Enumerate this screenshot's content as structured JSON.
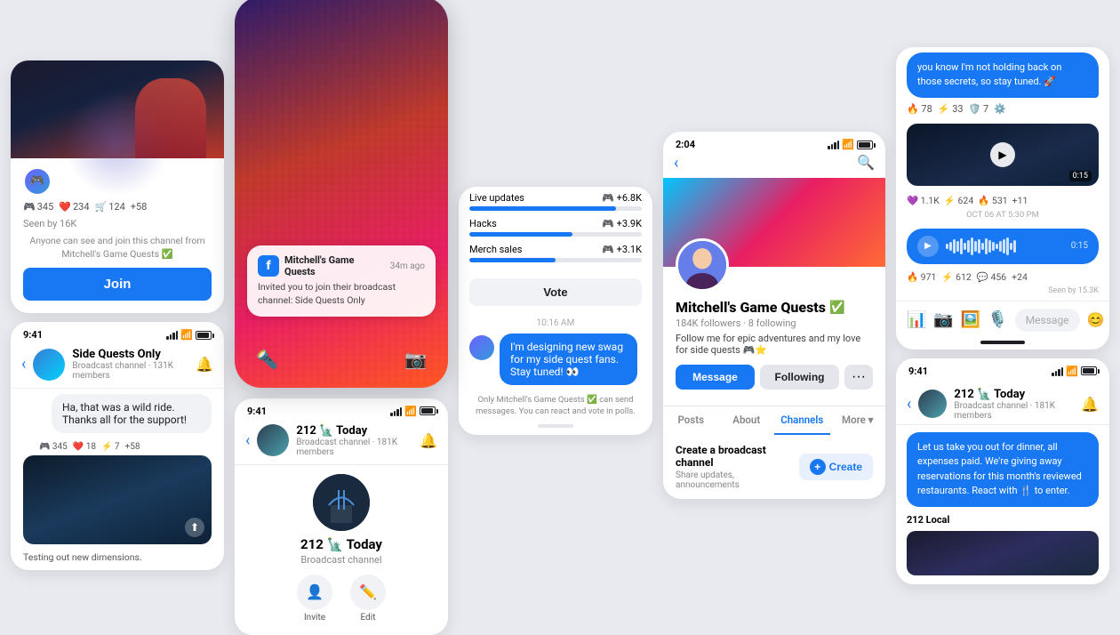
{
  "col1": {
    "card_top": {
      "reaction_items": [
        {
          "icon": "🎮",
          "count": "345"
        },
        {
          "icon": "❤️",
          "count": "234"
        },
        {
          "icon": "🛒",
          "count": "124"
        },
        {
          "icon": "",
          "count": "+58"
        }
      ],
      "seen_text": "Seen by 16K",
      "join_note": "Anyone can see and join this channel from Mitchell's Game Quests ✅",
      "join_button": "Join"
    },
    "card_chat": {
      "status_time": "9:41",
      "channel_name": "Side Quests Only",
      "channel_sub": "Broadcast channel · 131K members",
      "message": "Ha, that was a wild ride. Thanks all for the support!",
      "reactions": [
        {
          "icon": "🎮",
          "count": "345"
        },
        {
          "icon": "❤️",
          "count": "18"
        },
        {
          "icon": "⚡",
          "count": "7"
        },
        {
          "icon": "",
          "count": "+58"
        }
      ],
      "image_caption": "Testing out new dimensions."
    }
  },
  "col2": {
    "notification": {
      "sender": "Mitchell's Game Quests",
      "time": "34m ago",
      "body": "Invited you to join their broadcast channel: Side Quests Only"
    },
    "flashlight_icon": "🔦",
    "camera_icon": "📷",
    "broadcast": {
      "status_time": "9:41",
      "title": "212 🗽 Today",
      "subtitle": "Broadcast channel",
      "members": "181K members",
      "action_invite": "Invite",
      "action_edit": "Edit"
    }
  },
  "col3": {
    "poll": {
      "time": "10:16 AM",
      "items": [
        {
          "label": "Live updates",
          "stat": "🎮 +6.8K",
          "fill": 85,
          "color": "#1877f2"
        },
        {
          "label": "Hacks",
          "stat": "🎮 +3.9K",
          "fill": 60,
          "color": "#1877f2"
        },
        {
          "label": "Merch sales",
          "stat": "🎮 +3.1K",
          "fill": 50,
          "color": "#1877f2"
        }
      ],
      "vote_label": "Vote",
      "reply_time": "10:16 AM",
      "reply_message": "I'm designing new swag for my side quest fans. Stay tuned! 👀",
      "only_note": "Only Mitchell's Game Quests ✅ can send messages. You can react and vote in polls."
    }
  },
  "col4": {
    "profile": {
      "status_time": "2:04",
      "name": "Mitchell's Game Quests",
      "verified": true,
      "followers": "184K followers",
      "following": "8 following",
      "bio": "Follow me for epic adventures and my love for side quests 🎮⭐",
      "btn_message": "Message",
      "btn_following": "Following",
      "tabs": [
        "Posts",
        "About",
        "Channels",
        "More ▾"
      ],
      "active_tab": "Channels",
      "create_title": "Create a broadcast channel",
      "create_sub": "Share updates, announcements",
      "create_btn": "Create"
    }
  },
  "col5": {
    "card_top": {
      "message": "you know I'm not holding back on those secrets, so stay tuned. 🚀",
      "reactions": [
        {
          "icon": "🔥",
          "count": "78"
        },
        {
          "icon": "⚡",
          "count": "33"
        },
        {
          "icon": "🛡️",
          "count": "7"
        }
      ],
      "video_duration": "0:15",
      "video_reactions": [
        {
          "icon": "💜",
          "count": "1.1K"
        },
        {
          "icon": "⚡",
          "count": "624"
        },
        {
          "icon": "🔥",
          "count": "531"
        },
        {
          "icon": "",
          "count": "+11"
        }
      ],
      "date": "OCT 06 AT 5:30 PM",
      "audio_duration": "0:15",
      "audio_reactions": [
        {
          "icon": "🔥",
          "count": "971"
        },
        {
          "icon": "⚡",
          "count": "612"
        },
        {
          "icon": "💬",
          "count": "456"
        },
        {
          "icon": "",
          "count": "+24"
        }
      ],
      "seen": "Seen by 15.3K",
      "input_placeholder": "Message"
    },
    "card_bottom": {
      "status_time": "9:41",
      "title": "212 🗽 Today",
      "sub": "Broadcast channel · 181K members",
      "message": "Let us take you out for dinner, all expenses paid. We're giving away reservations for this month's reviewed restaurants. React with 🍴 to enter.",
      "local_name": "212 Local"
    }
  }
}
